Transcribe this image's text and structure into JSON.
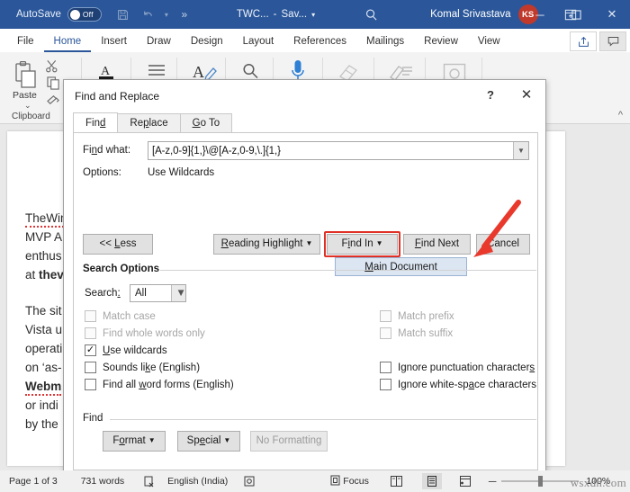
{
  "titlebar": {
    "autosave_label": "AutoSave",
    "autosave_state": "Off",
    "save_icon": "save-icon",
    "undo_icon": "undo-icon",
    "more_icon": "more-commands-icon",
    "doc_name": "TWC...",
    "doc_sep": "-",
    "doc_saved": "Sav...",
    "doc_caret": "▾",
    "search_icon": "search-icon",
    "user_name": "Komal Srivastava",
    "avatar_initials": "KS",
    "ribbon_display_icon": "ribbon-display-options-icon",
    "minimize": "─",
    "restore": "☐",
    "close": "✕",
    "bg_color": "#2b579a"
  },
  "ribbon_tabs": {
    "items": [
      {
        "label": "File",
        "active": false
      },
      {
        "label": "Home",
        "active": true
      },
      {
        "label": "Insert",
        "active": false
      },
      {
        "label": "Draw",
        "active": false
      },
      {
        "label": "Design",
        "active": false
      },
      {
        "label": "Layout",
        "active": false
      },
      {
        "label": "References",
        "active": false
      },
      {
        "label": "Mailings",
        "active": false
      },
      {
        "label": "Review",
        "active": false
      },
      {
        "label": "View",
        "active": false
      }
    ],
    "share_icon": "share-icon",
    "comments_icon": "comments-icon",
    "accent_color": "#2b579a"
  },
  "ribbon": {
    "clipboard_group_label": "Clipboard",
    "paste_label": "Paste",
    "paste_caret": "⌄",
    "dialog_launcher": "↘",
    "icons": [
      "paste-icon",
      "cut-scissors-icon",
      "copy-icon",
      "format-painter-icon",
      "font-color-icon",
      "paragraph-align-icon",
      "styles-icon",
      "find-search-icon",
      "dictate-microphone-icon",
      "eraser-icon",
      "editor-pen-icon",
      "media-frame-icon"
    ],
    "collapse_icon": "collapse-ribbon-chevron-icon"
  },
  "document": {
    "lines": [
      {
        "text": "TheWin",
        "bold": false,
        "squiggle": true
      },
      {
        "text": "MVP  A",
        "bold": false,
        "squiggle": false
      },
      {
        "text": "enthus",
        "bold": false,
        "squiggle": false
      },
      {
        "text": "at thev",
        "bold": false,
        "squiggle": false,
        "partial_bold": "thev"
      },
      {
        "text": "",
        "bold": false,
        "squiggle": false
      },
      {
        "text": "The sit",
        "bold": false,
        "squiggle": false
      },
      {
        "text": "Vista u",
        "bold": false,
        "squiggle": false
      },
      {
        "text": "operati",
        "bold": false,
        "squiggle": false
      },
      {
        "text": "on ‘as-",
        "bold": false,
        "squiggle": false
      },
      {
        "text": "Webm",
        "bold": true,
        "squiggle": true
      },
      {
        "text": "or indi",
        "bold": false,
        "squiggle": false
      },
      {
        "text": "by the",
        "bold": false,
        "squiggle": false
      }
    ]
  },
  "dialog": {
    "title": "Find and Replace",
    "help_icon": "?",
    "close_icon": "✕",
    "tabs": [
      {
        "label": "Find",
        "active": true,
        "accel": "d"
      },
      {
        "label": "Replace",
        "active": false,
        "accel": "p"
      },
      {
        "label": "Go To",
        "active": false,
        "accel": "G"
      }
    ],
    "find_what_label": "Find what:",
    "find_what_value": "[A-z,0-9]{1,}\\@[A-z,0-9,\\.]{1,}",
    "find_what_dropdown_icon": "chevron-down-icon",
    "options_label": "Options:",
    "options_value": "Use Wildcards",
    "buttons": {
      "less": "<< Less",
      "reading_highlight": "Reading Highlight",
      "find_in": "Find In",
      "find_next": "Find Next",
      "cancel": "Cancel"
    },
    "dropdown_menu": {
      "items": [
        "Main Document"
      ]
    },
    "highlight_color": "#e03127",
    "search_options_title": "Search Options",
    "search_label": "Search:",
    "search_value": "All",
    "checkboxes_left": [
      {
        "label": "Match case",
        "checked": false,
        "disabled": true,
        "accel": "M"
      },
      {
        "label": "Find whole words only",
        "checked": false,
        "disabled": true,
        "accel": "F"
      },
      {
        "label": "Use wildcards",
        "checked": true,
        "disabled": false,
        "accel": "U"
      },
      {
        "label": "Sounds like (English)",
        "checked": false,
        "disabled": false,
        "accel": "k"
      },
      {
        "label": "Find all word forms (English)",
        "checked": false,
        "disabled": false,
        "accel": "w"
      }
    ],
    "checkboxes_right": [
      {
        "label": "Match prefix",
        "checked": false,
        "disabled": true,
        "accel": "x"
      },
      {
        "label": "Match suffix",
        "checked": false,
        "disabled": true,
        "accel": "t"
      },
      {
        "label": "Ignore punctuation characters",
        "checked": false,
        "disabled": false,
        "accel": "s"
      },
      {
        "label": "Ignore white-space characters",
        "checked": false,
        "disabled": false,
        "accel": "a"
      }
    ],
    "find_section_title": "Find",
    "find_buttons": {
      "format": "Format",
      "special": "Special",
      "no_formatting": "No Formatting"
    }
  },
  "statusbar": {
    "page_info": "Page 1 of 3",
    "word_count": "731 words",
    "proofing_icon": "proofing-errors-icon",
    "language": "English (India)",
    "accessibility_icon": "accessibility-icon",
    "focus_icon": "focus-mode-icon",
    "focus_label": "Focus",
    "view_read_icon": "read-mode-icon",
    "view_print_icon": "print-layout-icon",
    "view_web_icon": "web-layout-icon",
    "zoom_out": "─",
    "zoom_in": "+",
    "zoom_level": "100%",
    "watermark": "wsxdn.com"
  }
}
